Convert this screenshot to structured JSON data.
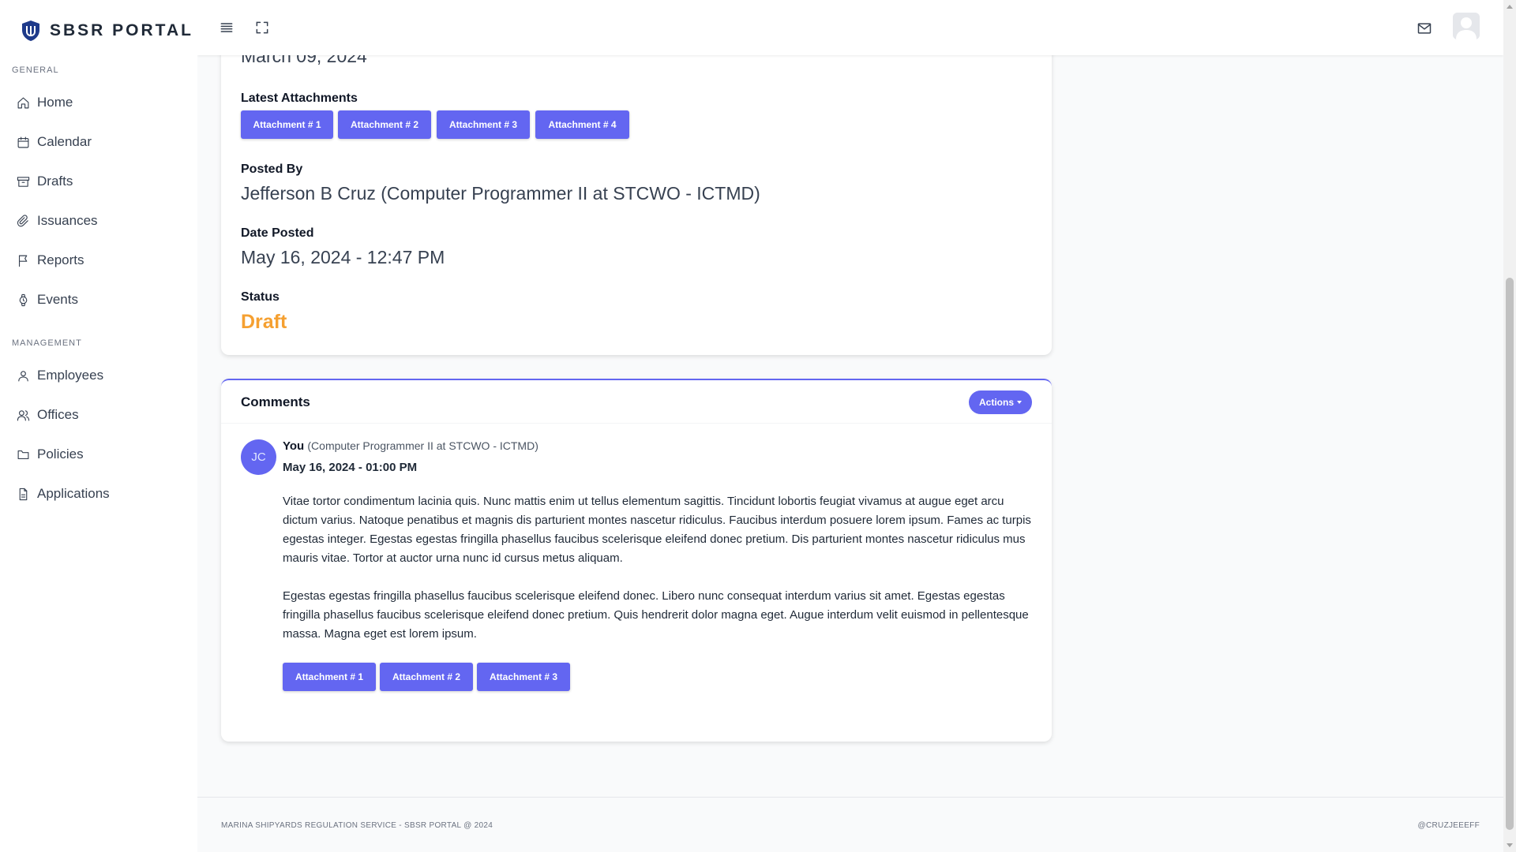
{
  "app": {
    "title": "SBSR PORTAL"
  },
  "sidebar": {
    "general_label": "GENERAL",
    "general_items": [
      {
        "label": "Home",
        "icon": "home-icon"
      },
      {
        "label": "Calendar",
        "icon": "calendar-icon"
      },
      {
        "label": "Drafts",
        "icon": "archive-icon"
      },
      {
        "label": "Issuances",
        "icon": "paperclip-icon"
      },
      {
        "label": "Reports",
        "icon": "flag-icon"
      },
      {
        "label": "Events",
        "icon": "watch-icon"
      }
    ],
    "management_label": "MANAGEMENT",
    "management_items": [
      {
        "label": "Employees",
        "icon": "user-icon"
      },
      {
        "label": "Offices",
        "icon": "users-icon"
      },
      {
        "label": "Policies",
        "icon": "folder-icon"
      },
      {
        "label": "Applications",
        "icon": "file-icon"
      }
    ]
  },
  "topbar": {
    "icons": [
      "menu-icon",
      "expand-icon",
      "mail-icon",
      "avatar"
    ]
  },
  "details": {
    "date_value": "March 09, 2024",
    "attachments_label": "Latest Attachments",
    "attachments": [
      "Attachment # 1",
      "Attachment # 2",
      "Attachment # 3",
      "Attachment # 4"
    ],
    "posted_by_label": "Posted By",
    "posted_by_value": "Jefferson B Cruz (Computer Programmer II at STCWO - ICTMD)",
    "date_posted_label": "Date Posted",
    "date_posted_value": "May 16, 2024 - 12:47 PM",
    "status_label": "Status",
    "status_value": "Draft",
    "status_color": "#f5a031"
  },
  "comments": {
    "title": "Comments",
    "actions_label": "Actions",
    "item": {
      "avatar_initials": "JC",
      "author": "You",
      "role": "(Computer Programmer II at STCWO - ICTMD)",
      "date": "May 16, 2024 - 01:00 PM",
      "paragraph1": "Vitae tortor condimentum lacinia quis. Nunc mattis enim ut tellus elementum sagittis. Tincidunt lobortis feugiat vivamus at augue eget arcu dictum varius. Natoque penatibus et magnis dis parturient montes nascetur ridiculus. Faucibus interdum posuere lorem ipsum. Fames ac turpis egestas integer. Egestas egestas fringilla phasellus faucibus scelerisque eleifend donec pretium. Dis parturient montes nascetur ridiculus mus mauris vitae. Tortor at auctor urna nunc id cursus metus aliquam.",
      "paragraph2": "Egestas egestas fringilla phasellus faucibus scelerisque eleifend donec. Libero nunc consequat interdum varius sit amet. Egestas egestas fringilla phasellus faucibus scelerisque eleifend donec pretium. Quis hendrerit dolor magna eget. Augue interdum velit euismod in pellentesque massa. Magna eget est lorem ipsum.",
      "attachments": [
        "Attachment # 1",
        "Attachment # 2",
        "Attachment # 3"
      ]
    }
  },
  "footer": {
    "left": "MARINA SHIPYARDS REGULATION SERVICE - SBSR PORTAL @ 2024",
    "right": "@CRUZJEEEFF"
  },
  "colors": {
    "accent": "#6366f1",
    "status_draft": "#f5a031"
  }
}
